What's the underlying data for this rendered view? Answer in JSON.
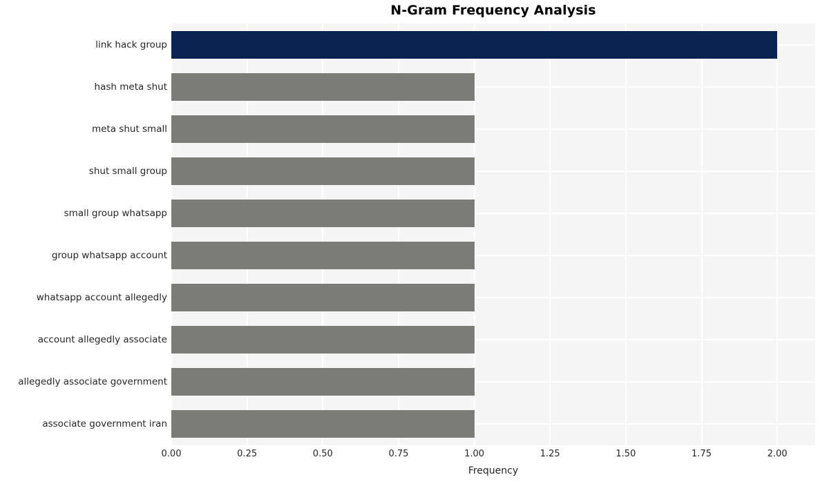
{
  "chart_data": {
    "type": "bar",
    "orientation": "horizontal",
    "title": "N-Gram Frequency Analysis",
    "xlabel": "Frequency",
    "ylabel": "",
    "categories": [
      "link hack group",
      "hash meta shut",
      "meta shut small",
      "shut small group",
      "small group whatsapp",
      "group whatsapp account",
      "whatsapp account allegedly",
      "account allegedly associate",
      "allegedly associate government",
      "associate government iran"
    ],
    "values": [
      2,
      1,
      1,
      1,
      1,
      1,
      1,
      1,
      1,
      1
    ],
    "bar_colors": [
      "#0a2351",
      "#7b7b78",
      "#7b7b78",
      "#7b7b78",
      "#7b7b78",
      "#7b7b78",
      "#7b7b78",
      "#7b7b78",
      "#7b7b78",
      "#7b7b78"
    ],
    "xlim": [
      0.0,
      2.125
    ],
    "xticks": [
      0.0,
      0.25,
      0.5,
      0.75,
      1.0,
      1.25,
      1.5,
      1.75,
      2.0
    ],
    "xtick_labels": [
      "0.00",
      "0.25",
      "0.50",
      "0.75",
      "1.00",
      "1.25",
      "1.50",
      "1.75",
      "2.00"
    ],
    "grid": true,
    "grid_color": "#ffffff",
    "plot_background": "#f5f5f5",
    "figure_background": "#ffffff",
    "legend": null,
    "highlight_color": "#0a2351",
    "default_color": "#7b7b78"
  }
}
